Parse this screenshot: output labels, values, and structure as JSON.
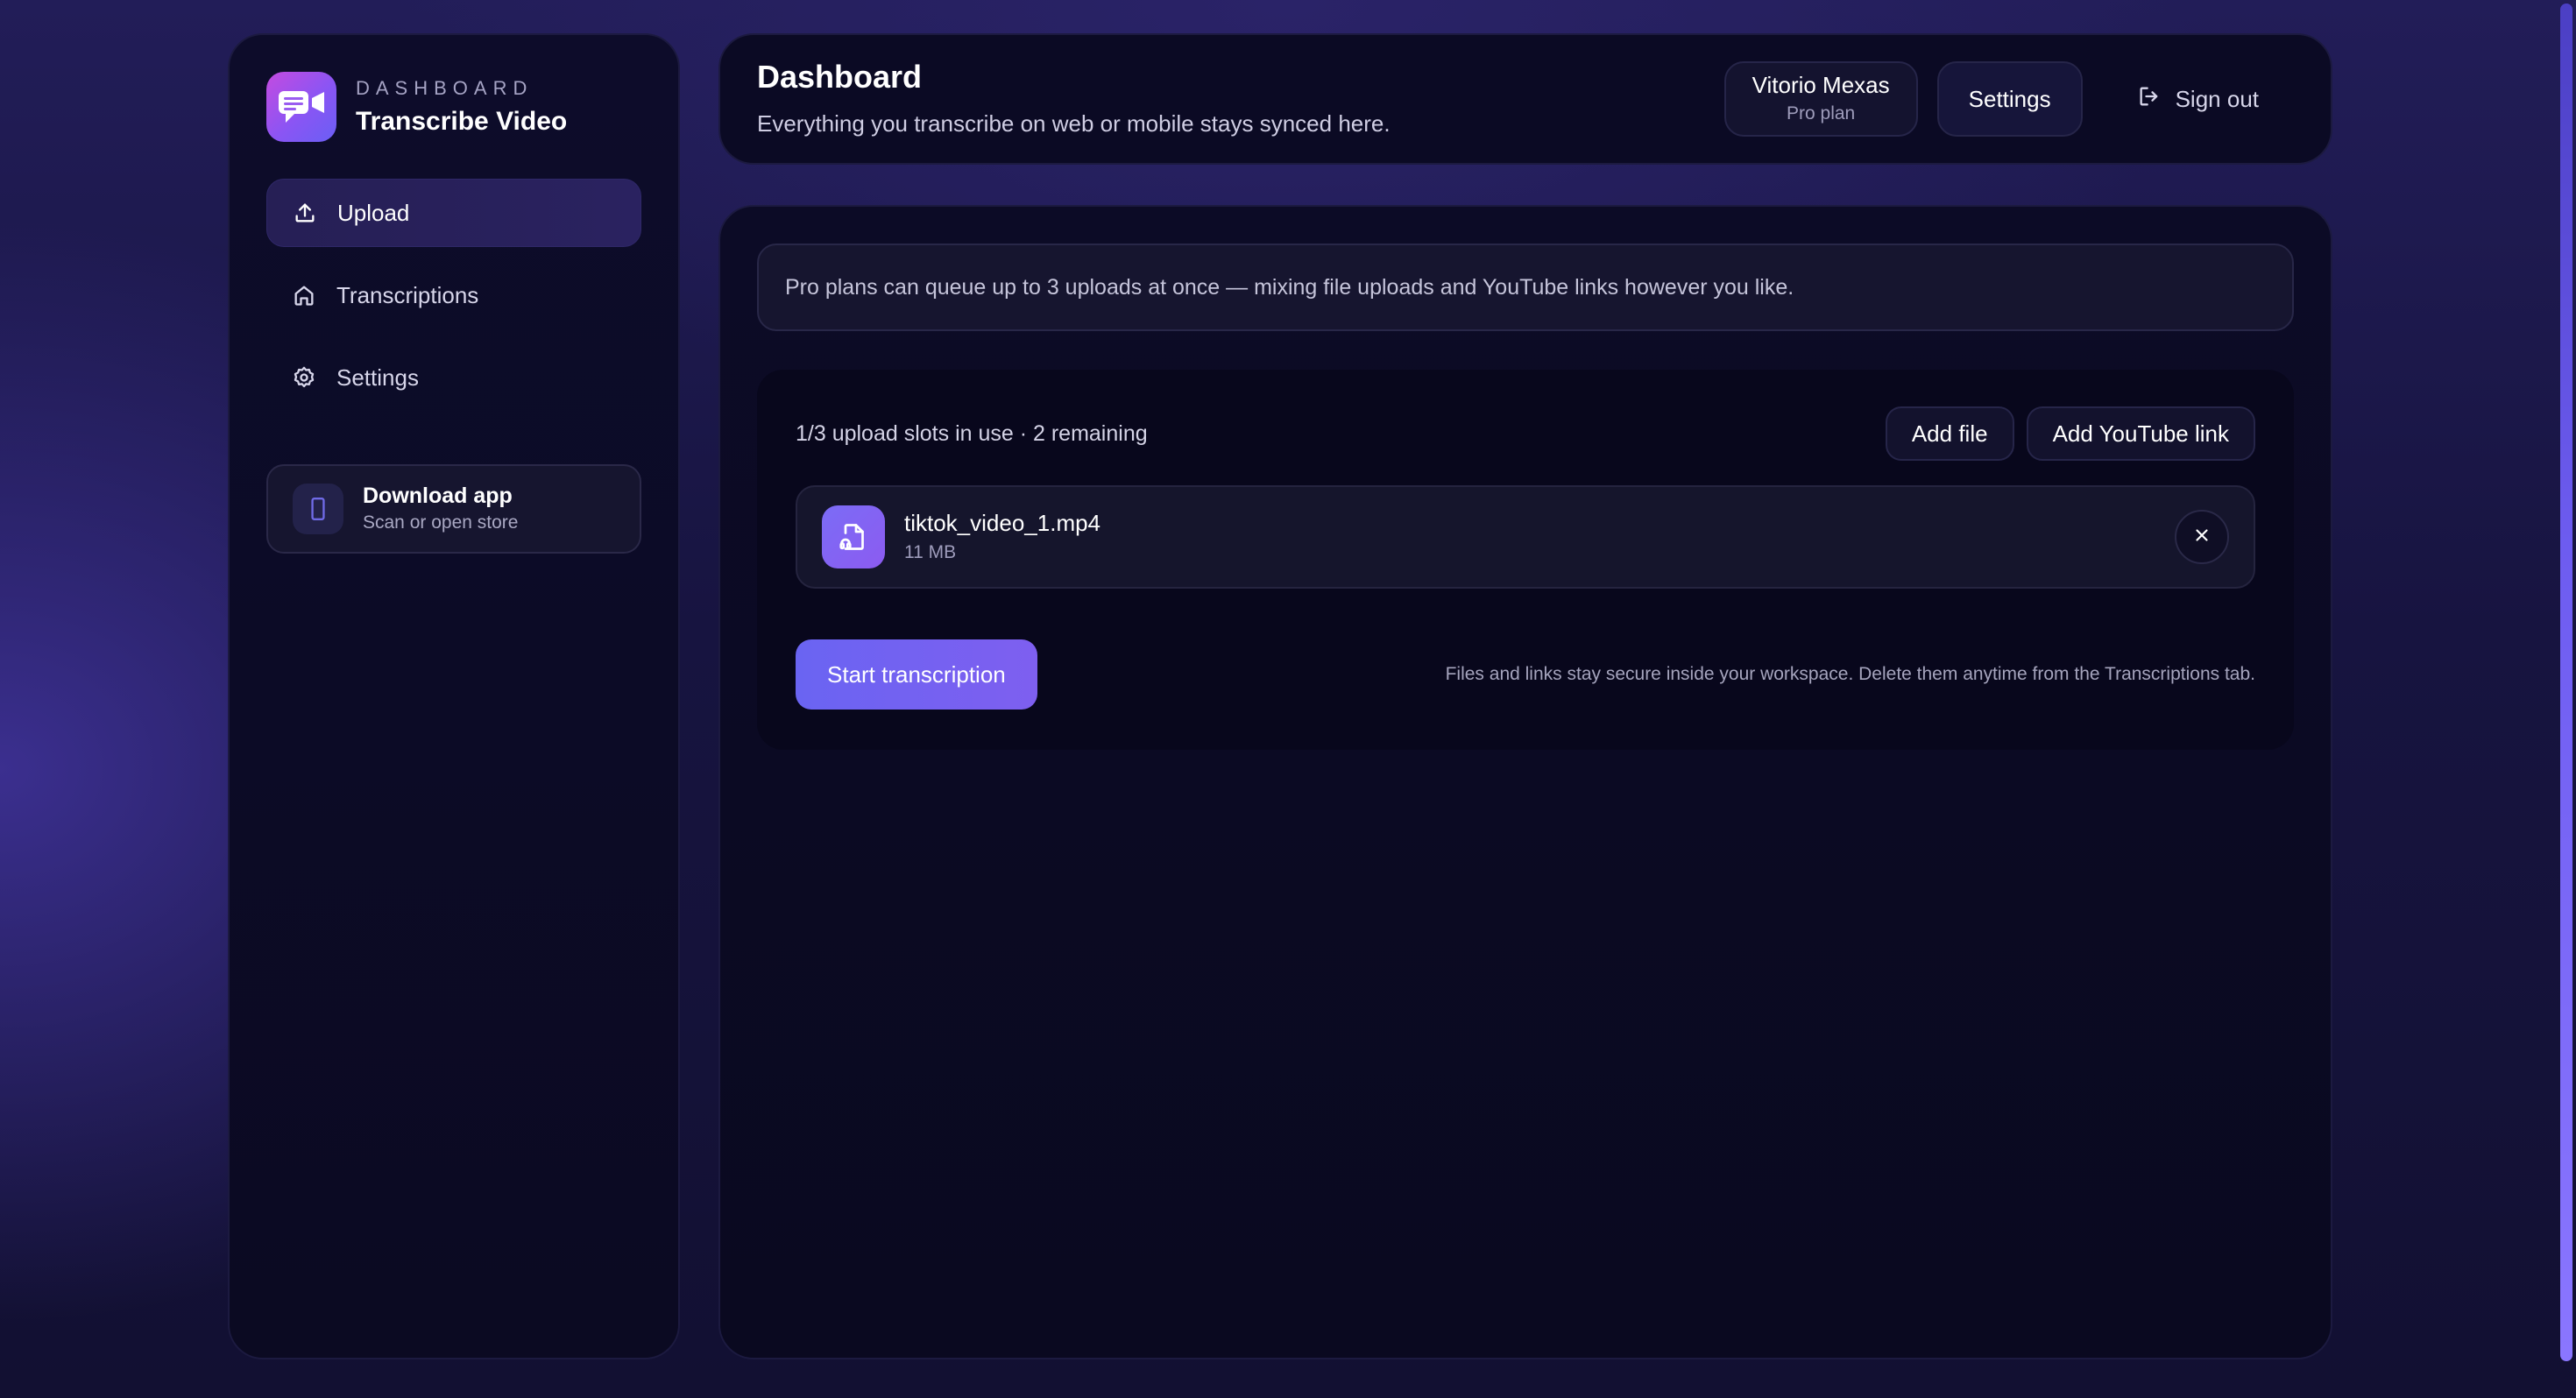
{
  "brand": {
    "eyebrow": "DASHBOARD",
    "title": "Transcribe Video",
    "logo_icon": "chat-video-icon"
  },
  "sidebar": {
    "items": [
      {
        "label": "Upload",
        "icon": "upload-icon",
        "active": true
      },
      {
        "label": "Transcriptions",
        "icon": "home-icon",
        "active": false
      },
      {
        "label": "Settings",
        "icon": "gear-icon",
        "active": false
      }
    ],
    "download": {
      "title": "Download app",
      "subtitle": "Scan or open store",
      "icon": "phone-icon"
    }
  },
  "header": {
    "title": "Dashboard",
    "subtitle": "Everything you transcribe on web or mobile stays synced here.",
    "user_name": "Vitorio Mexas",
    "user_plan": "Pro plan",
    "settings_label": "Settings",
    "signout_label": "Sign out"
  },
  "main": {
    "notice": "Pro plans can queue up to 3 uploads at once — mixing file uploads and YouTube links however you like.",
    "slots_text": "1/3 upload slots in use · 2 remaining",
    "add_file_label": "Add file",
    "add_youtube_label": "Add YouTube link",
    "files": [
      {
        "name": "tiktok_video_1.mp4",
        "size": "11 MB"
      }
    ],
    "start_label": "Start transcription",
    "footnote": "Files and links stay secure inside your workspace. Delete them anytime from the Transcriptions tab."
  },
  "colors": {
    "accent": "#7a62f2",
    "background": "#171440",
    "panel": "#0b0a24"
  }
}
